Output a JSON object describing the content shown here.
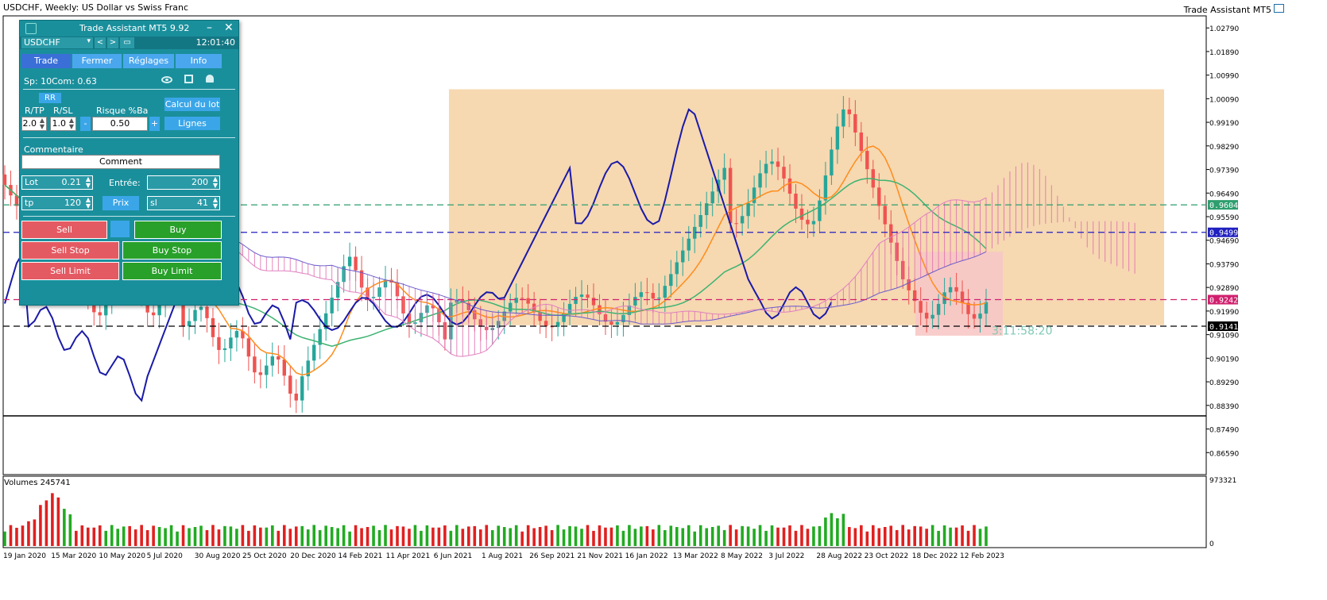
{
  "chart_title": "USDCHF, Weekly:  US Dollar vs Swiss Franc",
  "ta_label": "Trade Assistant MT5",
  "chart_data": {
    "type": "candlestick",
    "title": "USDCHF, Weekly:  US Dollar vs Swiss Franc",
    "ylim": [
      0.8575,
      1.0325
    ],
    "y_ticks": [
      "1.02790",
      "1.01890",
      "1.00990",
      "1.00090",
      "0.99190",
      "0.98290",
      "0.97390",
      "0.96490",
      "0.95590",
      "0.94690",
      "0.93790",
      "0.92890",
      "0.91990",
      "0.91090",
      "0.90190",
      "0.89290",
      "0.88390",
      "0.87490",
      "0.86590"
    ],
    "x_ticks": [
      "19 Jan 2020",
      "15 Mar 2020",
      "10 May 2020",
      "5 Jul 2020",
      "30 Aug 2020",
      "25 Oct 2020",
      "20 Dec 2020",
      "14 Feb 2021",
      "11 Apr 2021",
      "6 Jun 2021",
      "1 Aug 2021",
      "26 Sep 2021",
      "21 Nov 2021",
      "16 Jan 2022",
      "13 Mar 2022",
      "8 May 2022",
      "3 Jul 2022",
      "28 Aug 2022",
      "23 Oct 2022",
      "18 Dec 2022",
      "12 Feb 2023"
    ],
    "price_labels": [
      {
        "text": "0.96041",
        "value": 0.96041,
        "color": "#2e9e6e"
      },
      {
        "text": "0.94992",
        "value": 0.94992,
        "color": "#2020c0"
      },
      {
        "text": "0.92425",
        "value": 0.92425,
        "color": "#d0206e"
      },
      {
        "text": "0.91411",
        "value": 0.91411,
        "color": "#000000"
      }
    ],
    "timer_text": "3:11:58:20",
    "volume_label": "Volumes 245741",
    "volume_ylim": [
      0,
      973321
    ],
    "volume_ticks": [
      "973321",
      "0"
    ],
    "grid": false,
    "colors": {
      "bull": "#26a69a",
      "bear": "#ef5350",
      "tenkan": "#ff8c1a",
      "kijun": "#3cb371",
      "chikou": "#1a1aa8",
      "kumo": "#e070b0",
      "zone": "#f5d4a8"
    }
  },
  "panel": {
    "title": "Trade Assistant MT5 9.92",
    "symbol": "USDCHF",
    "time": "12:01:40",
    "tabs": [
      "Trade",
      "Fermer",
      "Réglages",
      "Info"
    ],
    "spread": "Sp: 10",
    "commission": "Com: 0.63",
    "rr_label": "RR",
    "rtp_label": "R/TP",
    "rsl_label": "R/SL",
    "rtp_value": "2.0",
    "rsl_value": "1.0",
    "risk_label": "Risque %Ba",
    "risk_value": "0.50",
    "minus": "-",
    "plus": "+",
    "calc_lot": "Calcul du lot",
    "lignes": "Lignes",
    "comment_label": "Commentaire",
    "comment_value": "Comment",
    "lot_label": "Lot",
    "lot_value": "0.21",
    "entry_label": "Entrée:",
    "entry_value": "200",
    "tp_label": "tp",
    "tp_value": "120",
    "prix": "Prix",
    "sl_label": "sl",
    "sl_value": "41",
    "sell": "Sell",
    "buy": "Buy",
    "sell_stop": "Sell Stop",
    "buy_stop": "Buy Stop",
    "sell_limit": "Sell Limit",
    "buy_limit": "Buy Limit"
  }
}
